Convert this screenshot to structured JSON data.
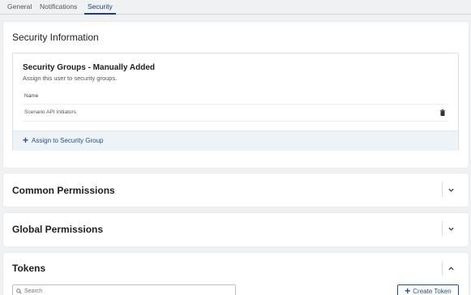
{
  "tabs": [
    {
      "label": "General"
    },
    {
      "label": "Notifications"
    },
    {
      "label": "Security"
    }
  ],
  "security_panel": {
    "title": "Security Information",
    "card": {
      "title": "Security Groups - Manually Added",
      "subtitle": "Assign this user to security groups.",
      "column_header": "Name",
      "rows": [
        {
          "name": "Scenario API Initiators"
        }
      ],
      "assign_label": "Assign to Security Group"
    }
  },
  "common_permissions": {
    "title": "Common Permissions"
  },
  "global_permissions": {
    "title": "Global Permissions"
  },
  "tokens": {
    "title": "Tokens",
    "search_placeholder": "Search",
    "create_label": "Create Token"
  },
  "colors": {
    "accent": "#1f4f8a",
    "active_tab": "#1f3f6e",
    "background": "#f0f1f3"
  }
}
